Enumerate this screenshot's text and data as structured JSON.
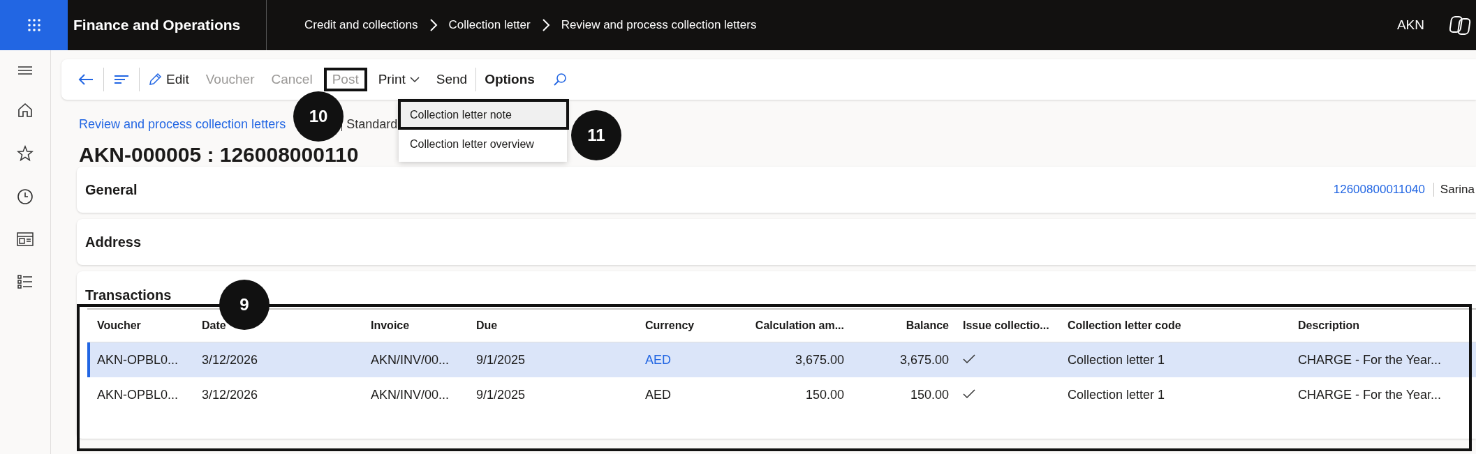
{
  "app": {
    "title": "Finance and Operations",
    "user": "AKN"
  },
  "breadcrumbs": [
    "Credit and collections",
    "Collection letter",
    "Review and process collection letters"
  ],
  "toolbar": [
    {
      "kind": "back"
    },
    {
      "kind": "lines"
    },
    {
      "kind": "edit",
      "label": "Edit",
      "disabled": false
    },
    {
      "kind": "action",
      "label": "Voucher",
      "disabled": true
    },
    {
      "kind": "action",
      "label": "Cancel",
      "disabled": true
    },
    {
      "kind": "action",
      "label": "Post",
      "disabled": true
    },
    {
      "kind": "dropdown",
      "label": "Print",
      "disabled": false,
      "expanded": true
    },
    {
      "kind": "action",
      "label": "Send",
      "disabled": false
    },
    {
      "kind": "menu",
      "label": "Options",
      "disabled": false
    },
    {
      "kind": "search"
    }
  ],
  "print_menu": [
    {
      "label": "Collection letter note",
      "selected": true
    },
    {
      "label": "Collection letter overview",
      "selected": false
    }
  ],
  "page": {
    "link": "Review and process collection letters",
    "view": "Standard",
    "title": "AKN-000005 : 126008000110"
  },
  "sections": [
    {
      "title": "General",
      "summary_link": "12600800011040",
      "summary_text": "Sarina"
    },
    {
      "title": "Address"
    }
  ],
  "transactions": {
    "title": "Transactions",
    "columns": [
      {
        "label": "Voucher"
      },
      {
        "label": "Date"
      },
      {
        "label": "Invoice"
      },
      {
        "label": "Due"
      },
      {
        "label": "Currency"
      },
      {
        "label": "Calculation am..."
      },
      {
        "label": "Balance"
      },
      {
        "label": "Issue collectio..."
      },
      {
        "label": "Collection letter code"
      },
      {
        "label": "Description"
      }
    ],
    "rows": [
      {
        "selected": true,
        "voucher": "AKN-OPBL0...",
        "date": "3/12/2026",
        "invoice": "AKN/INV/00...",
        "due": "9/1/2025",
        "currency": "AED",
        "calculation": "3,675.00",
        "balance": "3,675.00",
        "issue": true,
        "code": "Collection letter 1",
        "description": "CHARGE - For the Year..."
      },
      {
        "selected": false,
        "voucher": "AKN-OPBL0...",
        "date": "3/12/2026",
        "invoice": "AKN/INV/00...",
        "due": "9/1/2025",
        "currency": "AED",
        "calculation": "150.00",
        "balance": "150.00",
        "issue": true,
        "code": "Collection letter 1",
        "description": "CHARGE - For the Year..."
      }
    ]
  },
  "annotations": [
    {
      "label": "9"
    },
    {
      "label": "10"
    },
    {
      "label": "11"
    }
  ]
}
